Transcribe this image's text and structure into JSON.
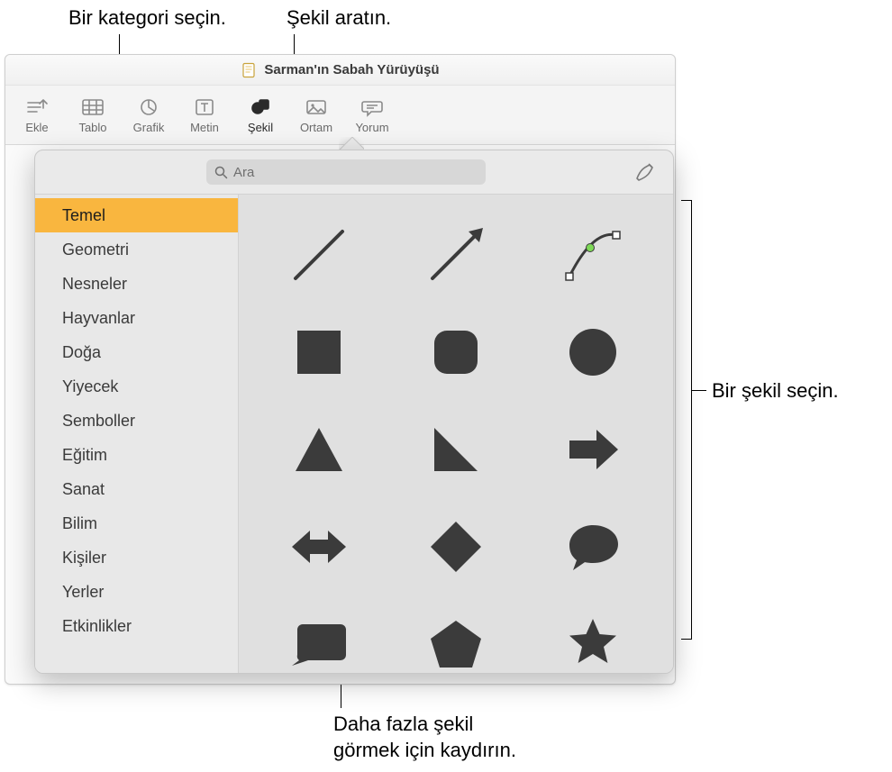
{
  "callouts": {
    "choose_category": "Bir kategori seçin.",
    "search_shape": "Şekil aratın.",
    "choose_shape": "Bir şekil seçin.",
    "scroll_more": "Daha fazla şekil\ngörmek için kaydırın."
  },
  "window": {
    "title": "Sarman'ın Sabah Yürüyüşü"
  },
  "toolbar": {
    "items": [
      {
        "id": "insert",
        "label": "Ekle"
      },
      {
        "id": "table",
        "label": "Tablo"
      },
      {
        "id": "chart",
        "label": "Grafik"
      },
      {
        "id": "text",
        "label": "Metin"
      },
      {
        "id": "shape",
        "label": "Şekil"
      },
      {
        "id": "media",
        "label": "Ortam"
      },
      {
        "id": "comment",
        "label": "Yorum"
      }
    ]
  },
  "popover": {
    "search_placeholder": "Ara",
    "pen_tool_name": "draw-shape-icon"
  },
  "sidebar": {
    "items": [
      {
        "label": "Temel",
        "selected": true
      },
      {
        "label": "Geometri",
        "selected": false
      },
      {
        "label": "Nesneler",
        "selected": false
      },
      {
        "label": "Hayvanlar",
        "selected": false
      },
      {
        "label": "Doğa",
        "selected": false
      },
      {
        "label": "Yiyecek",
        "selected": false
      },
      {
        "label": "Semboller",
        "selected": false
      },
      {
        "label": "Eğitim",
        "selected": false
      },
      {
        "label": "Sanat",
        "selected": false
      },
      {
        "label": "Bilim",
        "selected": false
      },
      {
        "label": "Kişiler",
        "selected": false
      },
      {
        "label": "Yerler",
        "selected": false
      },
      {
        "label": "Etkinlikler",
        "selected": false
      }
    ]
  },
  "shapes": [
    {
      "name": "line"
    },
    {
      "name": "arrow-line"
    },
    {
      "name": "curve"
    },
    {
      "name": "square"
    },
    {
      "name": "rounded-square"
    },
    {
      "name": "circle"
    },
    {
      "name": "triangle"
    },
    {
      "name": "right-triangle"
    },
    {
      "name": "arrow-right"
    },
    {
      "name": "arrow-bidirectional"
    },
    {
      "name": "diamond"
    },
    {
      "name": "speech-bubble"
    },
    {
      "name": "quote-bubble"
    },
    {
      "name": "pentagon"
    },
    {
      "name": "star"
    }
  ]
}
